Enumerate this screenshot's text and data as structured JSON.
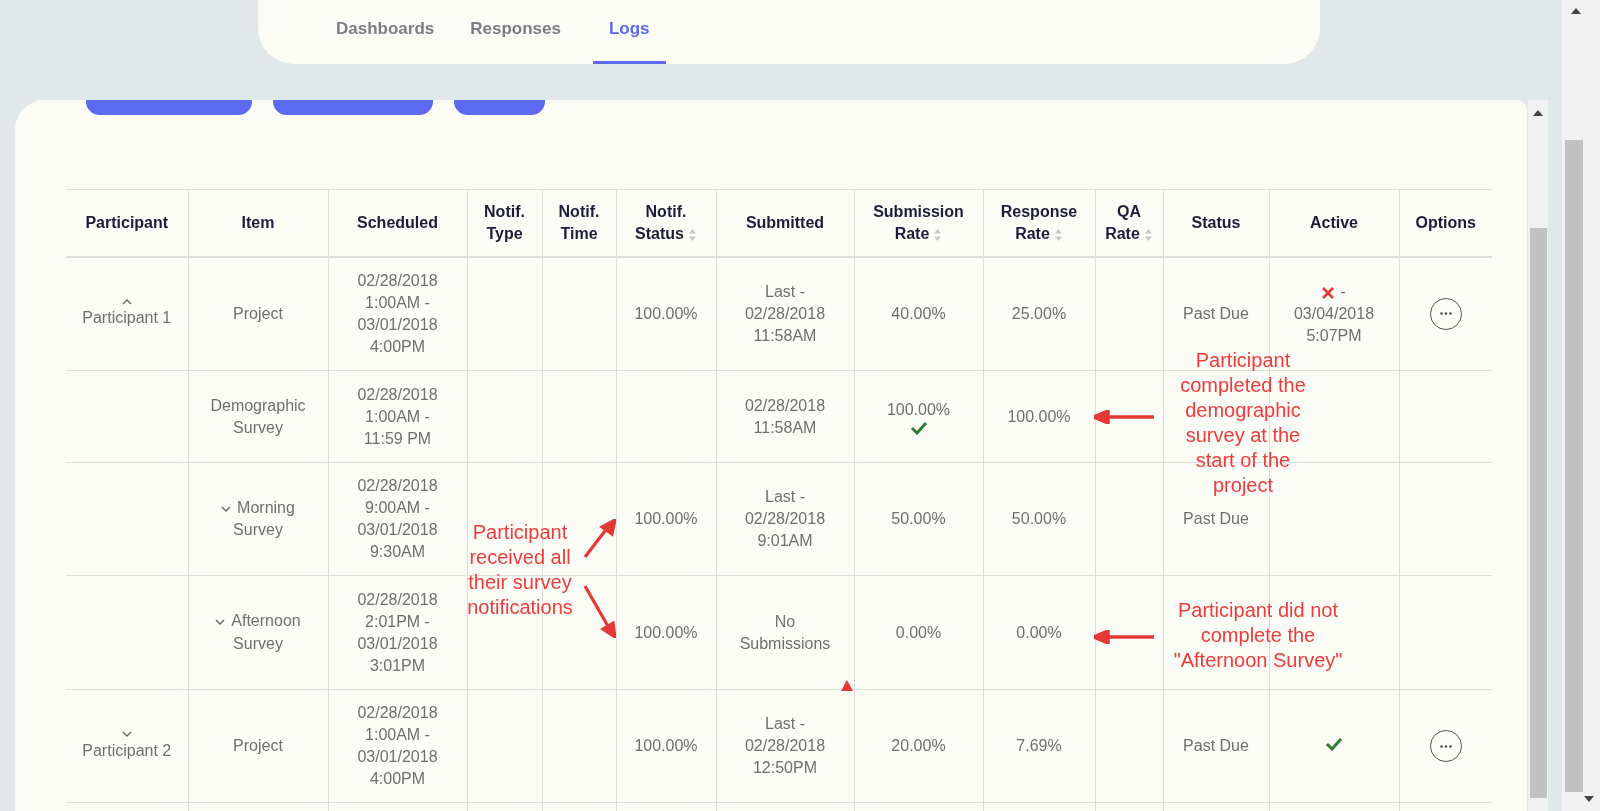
{
  "tabs": [
    {
      "label": "Dashboards",
      "selected": false
    },
    {
      "label": "Responses",
      "selected": false
    },
    {
      "label": "Logs",
      "selected": true
    }
  ],
  "columns": [
    {
      "label": "Participant",
      "sortable": false
    },
    {
      "label": "Item",
      "sortable": false
    },
    {
      "label": "Scheduled",
      "sortable": false
    },
    {
      "label": "Notif. Type",
      "sortable": false
    },
    {
      "label": "Notif. Time",
      "sortable": false
    },
    {
      "label": "Notif. Status",
      "sortable": true
    },
    {
      "label": "Submitted",
      "sortable": false
    },
    {
      "label": "Submission Rate",
      "sortable": true
    },
    {
      "label": "Response Rate",
      "sortable": true
    },
    {
      "label": "QA Rate",
      "sortable": true
    },
    {
      "label": "Status",
      "sortable": false
    },
    {
      "label": "Active",
      "sortable": false
    },
    {
      "label": "Options",
      "sortable": false
    }
  ],
  "rows": [
    {
      "participant": {
        "label": "Participant 1",
        "expanded": true
      },
      "item": {
        "label": "Project"
      },
      "scheduled": "02/28/2018 1:00AM - 03/01/2018 4:00PM",
      "notif_status": "100.00%",
      "submitted": "Last - 02/28/2018 11:58AM",
      "submission_rate": "40.00%",
      "submission_complete": false,
      "response_rate": "25.00%",
      "status": "Past Due",
      "active": {
        "kind": "inactive",
        "text": "- 03/04/2018 5:07PM"
      },
      "options": true
    },
    {
      "item": {
        "label": "Demographic Survey"
      },
      "scheduled": "02/28/2018 1:00AM - 11:59 PM",
      "submitted": "02/28/2018 11:58AM",
      "submission_rate": "100.00%",
      "submission_complete": true,
      "response_rate": "100.00%",
      "options": false
    },
    {
      "item": {
        "label": "Morning Survey",
        "expanded": false
      },
      "scheduled": "02/28/2018 9:00AM - 03/01/2018 9:30AM",
      "notif_status": "100.00%",
      "submitted": "Last - 02/28/2018 9:01AM",
      "submission_rate": "50.00%",
      "submission_complete": false,
      "response_rate": "50.00%",
      "status": "Past Due",
      "options": false
    },
    {
      "item": {
        "label": "Afternoon Survey",
        "expanded": false
      },
      "scheduled": "02/28/2018 2:01PM - 03/01/2018 3:01PM",
      "notif_status": "100.00%",
      "submitted": "No Submissions",
      "submission_rate": "0.00%",
      "submission_complete": false,
      "response_rate": "0.00%",
      "options": false
    },
    {
      "participant": {
        "label": "Participant 2",
        "expanded": false
      },
      "item": {
        "label": "Project"
      },
      "scheduled": "02/28/2018 1:00AM - 03/01/2018 4:00PM",
      "notif_status": "100.00%",
      "submitted": "Last - 02/28/2018 12:50PM",
      "submission_rate": "20.00%",
      "submission_complete": false,
      "response_rate": "7.69%",
      "status": "Past Due",
      "active": {
        "kind": "active"
      },
      "options": true
    }
  ],
  "annotations": [
    {
      "text": "Participant completed the demographic survey at the start of the project",
      "kind": "left"
    },
    {
      "text": "Participant received all their survey notifications",
      "kind": "split"
    },
    {
      "text": "Participant did not complete the \"Afternoon Survey\"",
      "kind": "left"
    }
  ]
}
